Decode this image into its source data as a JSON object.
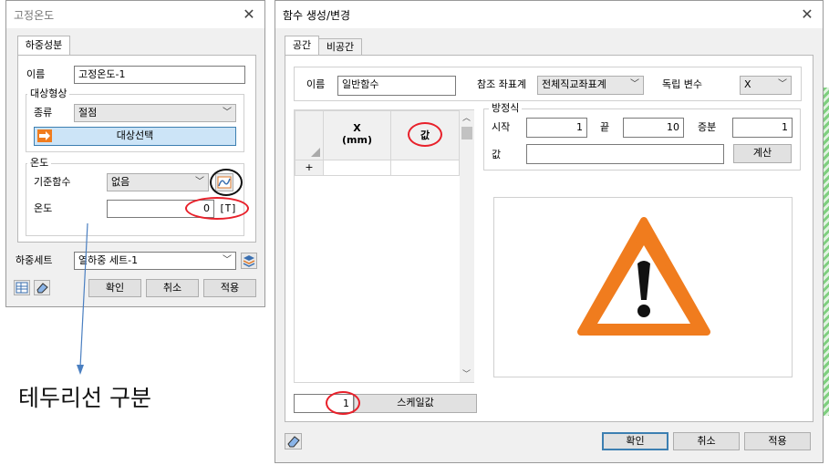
{
  "left_dialog": {
    "title": "고정온도",
    "tab": "하중성분",
    "name_label": "이름",
    "name_value": "고정온도-1",
    "target_group": "대상형상",
    "kind_label": "종류",
    "kind_value": "절점",
    "select_target_button": "대상선택",
    "temp_group": "온도",
    "base_func_label": "기준함수",
    "base_func_value": "없음",
    "temp_label": "온도",
    "temp_value": "0",
    "temp_unit": "[T]",
    "load_set_label": "하중세트",
    "load_set_value": "열하중 세트-1",
    "ok_button": "확인",
    "cancel_button": "취소",
    "apply_button": "적용"
  },
  "annotation": {
    "text": "테두리선 구분",
    "colors": {
      "highlight": "#e8202a",
      "arrow": "#4a7fc1"
    }
  },
  "right_dialog": {
    "title": "함수 생성/변경",
    "tabs": [
      "공간",
      "비공간"
    ],
    "name_label": "이름",
    "name_value": "일반함수",
    "ref_coord_label": "참조 좌표계",
    "ref_coord_value": "전체직교좌표계",
    "indep_var_label": "독립 변수",
    "indep_var_value": "X",
    "table": {
      "col_x": "X",
      "col_x_unit": "(mm)",
      "col_val": "값",
      "add_row": "+"
    },
    "equation_group": "방정식",
    "start_label": "시작",
    "start_value": "1",
    "end_label": "끝",
    "end_value": "10",
    "increment_label": "증분",
    "increment_value": "1",
    "value_label": "값",
    "value_value": "",
    "calc_button": "계산",
    "scale_value": "1",
    "scale_button": "스케일값",
    "ok_button": "확인",
    "cancel_button": "취소",
    "apply_button": "적용",
    "warning_colors": {
      "orange": "#f07c1e",
      "dark": "#111111"
    }
  }
}
